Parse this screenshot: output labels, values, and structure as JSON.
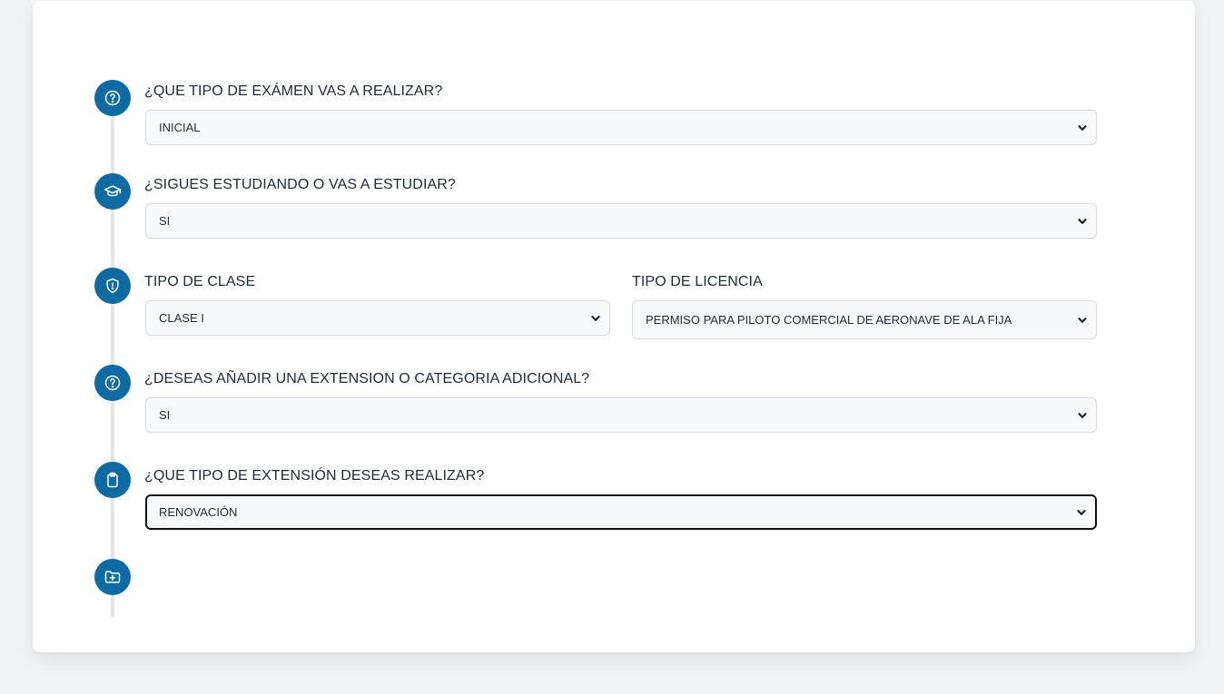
{
  "form": {
    "exam_type": {
      "label": "¿QUE TIPO DE EXÁMEN VAS A REALIZAR?",
      "value": "INICIAL",
      "icon": "question-circle-icon"
    },
    "studying": {
      "label": "¿SIGUES ESTUDIANDO O VAS A ESTUDIAR?",
      "value": "SI",
      "icon": "graduation-cap-icon"
    },
    "class_type": {
      "label": "TIPO DE CLASE",
      "value": "CLASE I",
      "icon": "shield-alert-icon"
    },
    "license_type": {
      "label": "TIPO DE LICENCIA",
      "value": "PERMISO PARA PILOTO COMERCIAL DE AERONAVE DE ALA FIJA"
    },
    "add_extension": {
      "label": "¿DESEAS AÑADIR UNA EXTENSION O CATEGORIA ADICIONAL?",
      "value": "SI",
      "icon": "question-circle-icon"
    },
    "extension_type": {
      "label": "¿QUE TIPO DE EXTENSIÓN DESEAS REALIZAR?",
      "value": "RENOVACIÓN",
      "icon": "clipboard-icon"
    },
    "next_step": {
      "icon": "folder-plus-icon"
    }
  },
  "colors": {
    "accent": "#0e6aa2",
    "background": "#f2f3f5",
    "card": "#ffffff",
    "timeline": "#e3e5e8",
    "text": "#1f2a37"
  }
}
